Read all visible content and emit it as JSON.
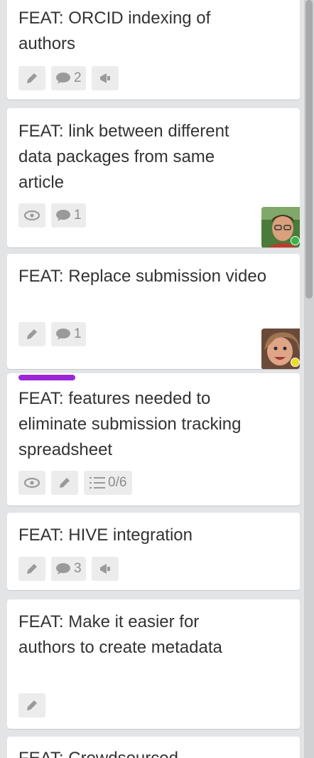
{
  "cards": [
    {
      "title": "FEAT: ORCID indexing of authors",
      "badges": {
        "edit_icon": "pencil-icon",
        "comments": "2",
        "comment_icon": "speech-bubble-icon",
        "vote_icon": "megaphone-icon"
      }
    },
    {
      "title": "FEAT: link between different data packages from same article",
      "badges": {
        "watch_icon": "eye-icon",
        "comments": "1",
        "comment_icon": "speech-bubble-icon"
      },
      "member": {
        "avatar_icon": "member-avatar-man",
        "status_color": "#3cb34a"
      }
    },
    {
      "title": "FEAT: Replace submission video",
      "badges": {
        "edit_icon": "pencil-icon",
        "comments": "1",
        "comment_icon": "speech-bubble-icon"
      },
      "member": {
        "avatar_icon": "member-avatar-woman",
        "status_color": "#e8dc2a"
      }
    },
    {
      "title": "FEAT: features needed to eliminate submission tracking spreadsheet",
      "label_color": "#9d27d8",
      "badges": {
        "watch_icon": "eye-icon",
        "edit_icon": "pencil-icon",
        "checklist": "0/6",
        "checklist_icon": "checklist-icon"
      }
    },
    {
      "title": "FEAT: HIVE integration",
      "badges": {
        "edit_icon": "pencil-icon",
        "comments": "3",
        "comment_icon": "speech-bubble-icon",
        "vote_icon": "megaphone-icon"
      }
    },
    {
      "title": "FEAT: Make it easier for authors to create metadata",
      "badges": {
        "edit_icon": "pencil-icon"
      }
    },
    {
      "title": "FEAT: Crowdsourced"
    }
  ],
  "colors": {
    "list_background": "#e2e4e6",
    "card_background": "#ffffff",
    "badge_background": "#ececec",
    "badge_icon": "#8c8c8c"
  }
}
